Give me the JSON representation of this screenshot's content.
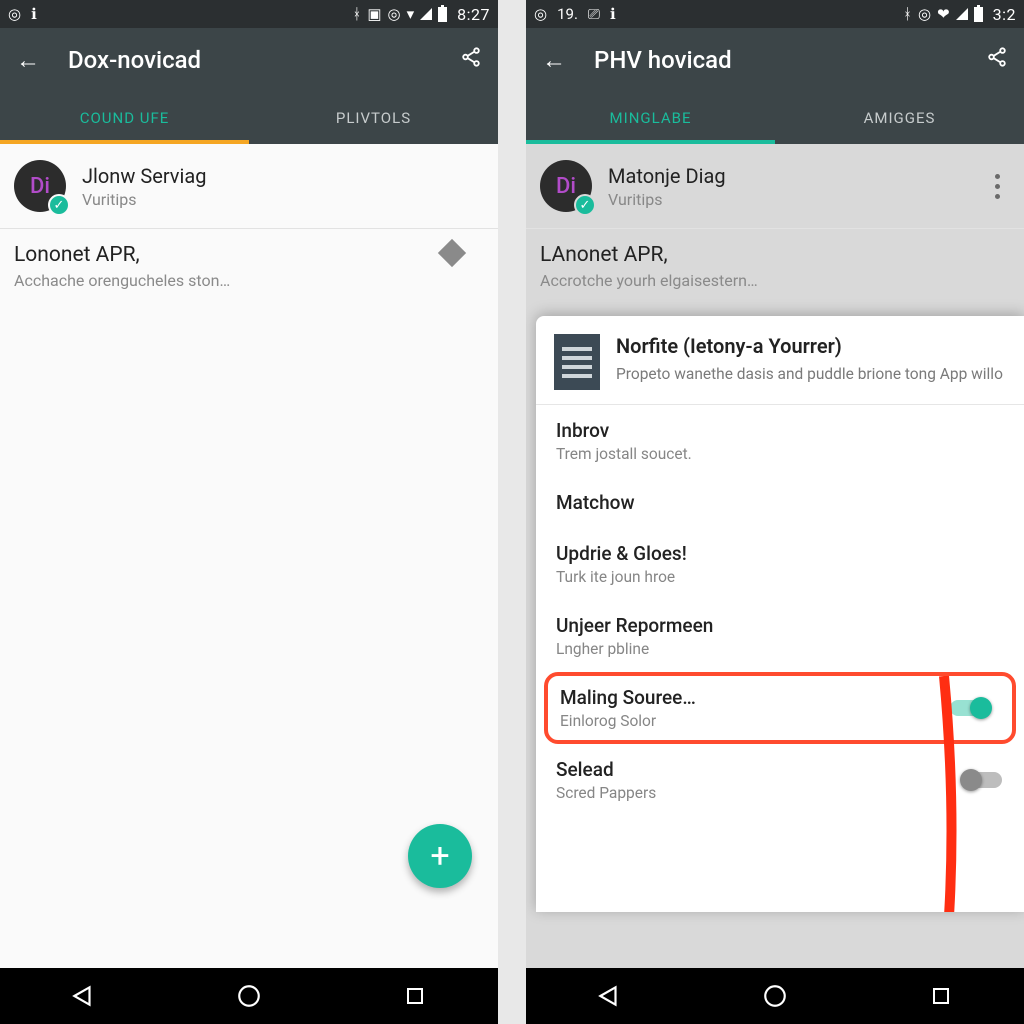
{
  "left": {
    "status": {
      "clock": "8:27"
    },
    "appbar": {
      "title": "Dox-novicad"
    },
    "tabs": {
      "active": "COUND UFE",
      "inactive": "PLIVTOLS"
    },
    "profile": {
      "initials": "Di",
      "name": "Jlonw Serviag",
      "sub": "Vuritips"
    },
    "section": {
      "title": "Lononet APR,",
      "sub": "Acchache orengucheles ston…"
    },
    "fab": "+"
  },
  "right": {
    "status": {
      "left_text": "19.",
      "clock": "3:2"
    },
    "appbar": {
      "title": "PHV hovicad"
    },
    "tabs": {
      "active": "MINGLABE",
      "inactive": "AMIGGES"
    },
    "profile": {
      "initials": "Di",
      "name": "Matonje Diag",
      "sub": "Vuritips"
    },
    "section": {
      "title": "LAnonet APR,",
      "sub": "Accrotche yourh elgaisestern…"
    },
    "card": {
      "title": "Norfite (Ietony-a Yourrer)",
      "desc": "Propeto wanethe dasis and puddle brione tong App willo",
      "options": [
        {
          "title": "Inbrov",
          "sub": "Trem jostall soucet."
        },
        {
          "title": "Matchow"
        },
        {
          "title": "Updrie & Gloes!",
          "sub": "Turk ite joun hroe"
        },
        {
          "title": "Unjeer Repormeen",
          "sub": "Lngher pbline"
        },
        {
          "title": "Maling Souree…",
          "sub": "Einlorog Solor",
          "toggle": "on",
          "highlight": true
        },
        {
          "title": "Selead",
          "sub": "Scred Pappers",
          "toggle": "off"
        }
      ]
    }
  }
}
